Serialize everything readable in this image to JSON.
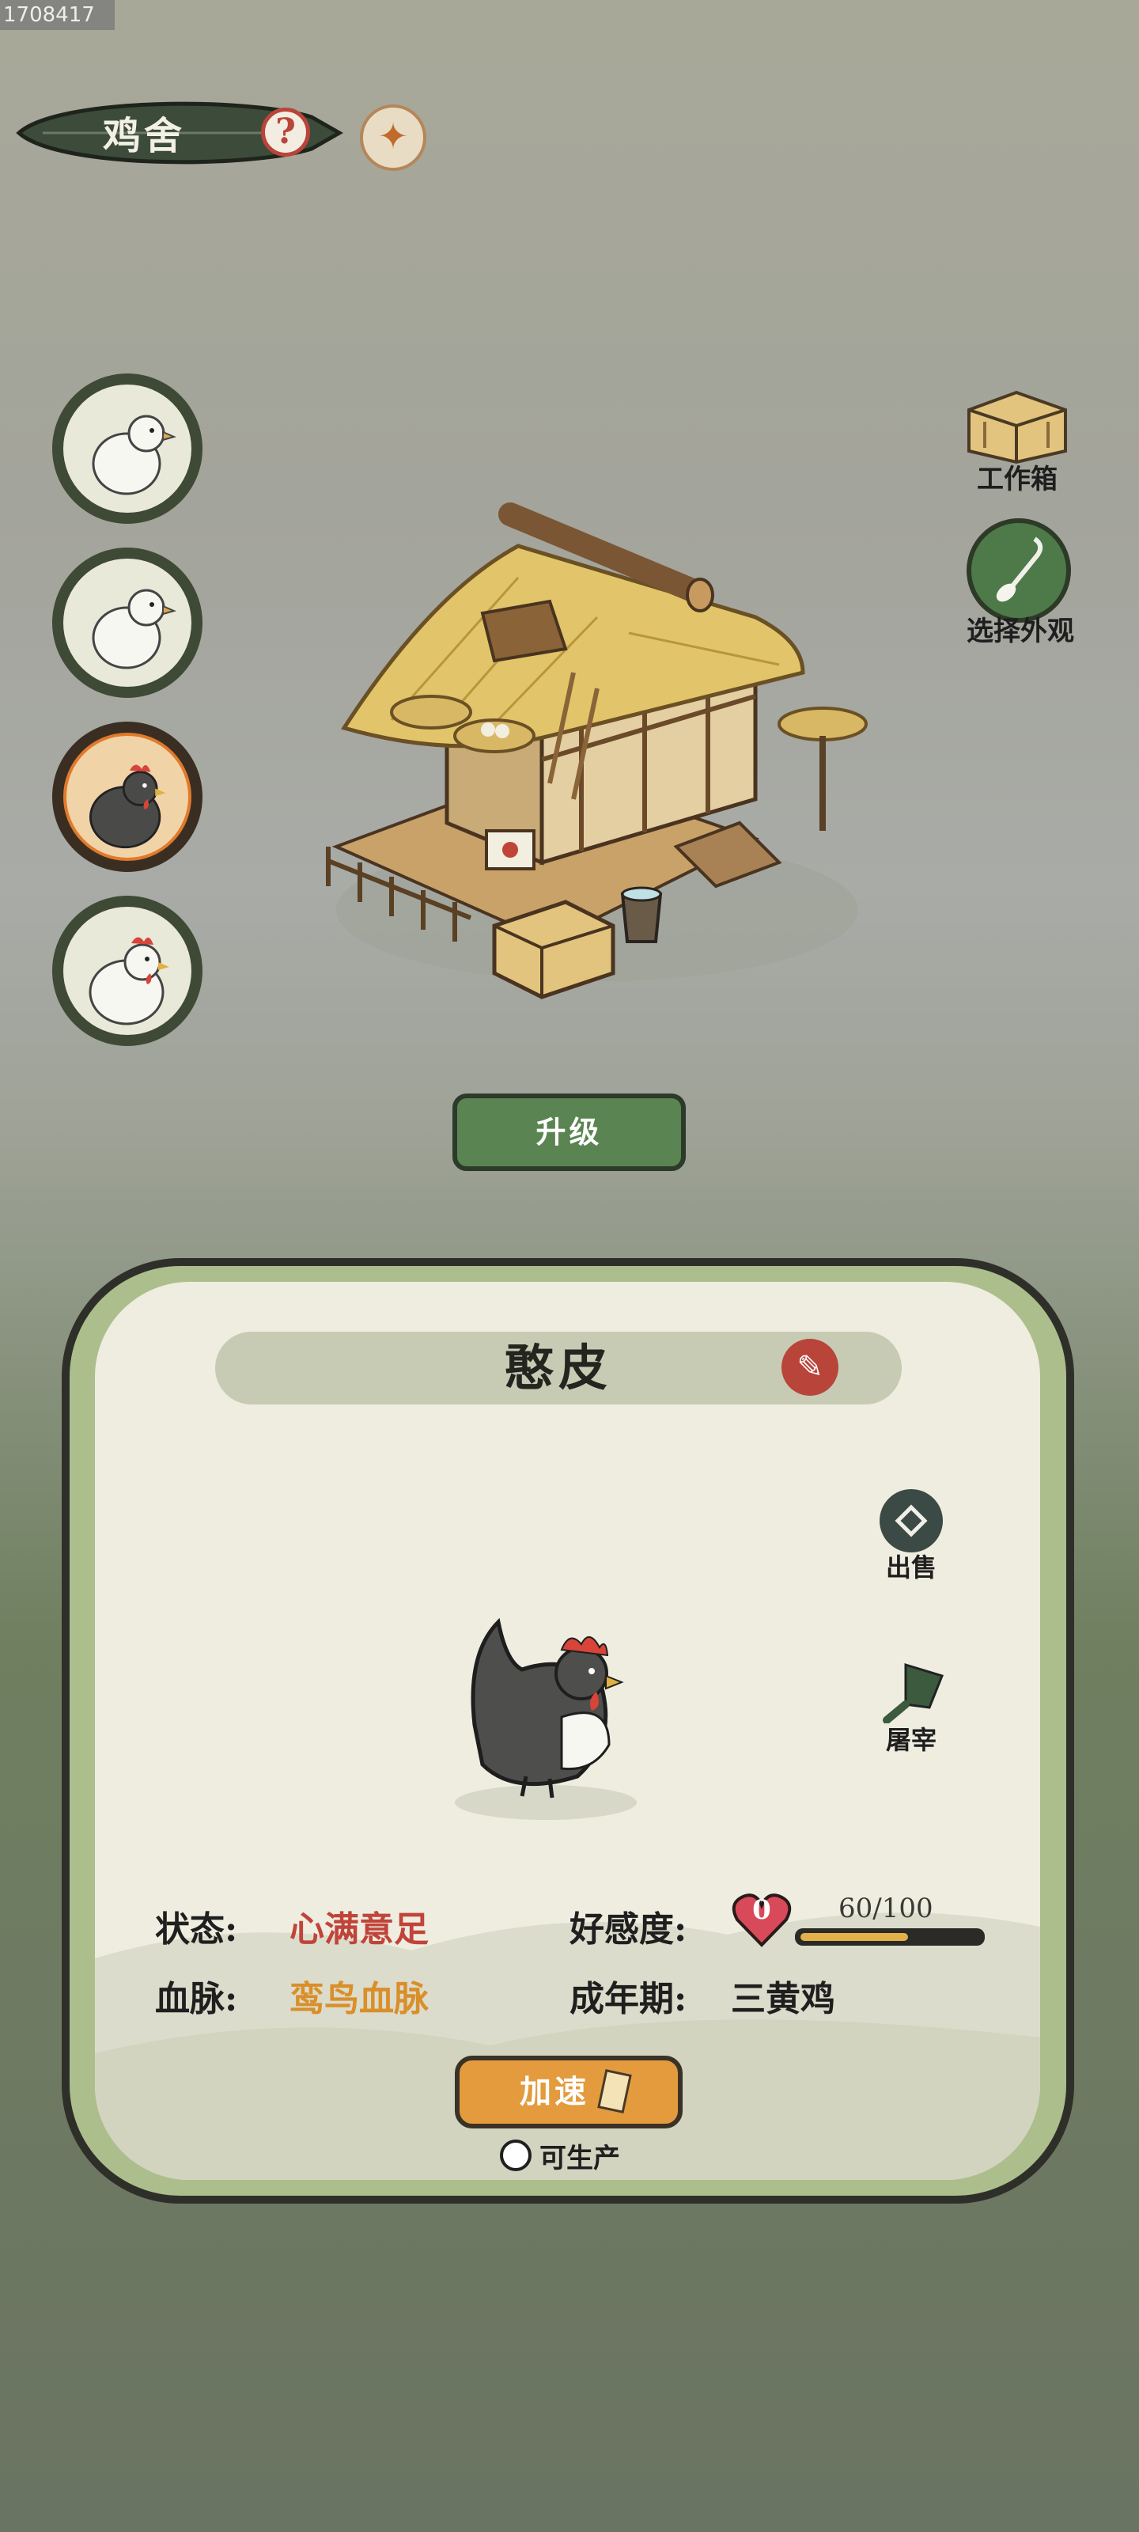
{
  "overlay_id": "1708417",
  "header": {
    "title": "鸡舍",
    "help_icon": "question-mark",
    "phoenix_icon": "phoenix"
  },
  "avatars": [
    {
      "kind": "white-dove"
    },
    {
      "kind": "white-dove"
    },
    {
      "kind": "black-hen",
      "selected": true
    },
    {
      "kind": "white-hen"
    }
  ],
  "right_actions": {
    "workbox_label": "工作箱",
    "appearance_label": "选择外观"
  },
  "upgrade_label": "升级",
  "panel": {
    "name": "憨皮",
    "sell_label": "出售",
    "slaughter_label": "屠宰",
    "stats": {
      "status_label": "状态:",
      "status_value": "心满意足",
      "bloodline_label": "血脉:",
      "bloodline_value": "鸾鸟血脉",
      "favor_label": "好感度:",
      "favor_level": "0",
      "favor_text": "60/100",
      "favor_fraction": 0.6,
      "adult_label": "成年期:",
      "adult_value": "三黄鸡"
    },
    "speed_label": "加速",
    "produce_label": "可生产"
  },
  "colors": {
    "accent_green": "#5a8451",
    "accent_red": "#c0443a",
    "accent_orange": "#e39b3e"
  }
}
